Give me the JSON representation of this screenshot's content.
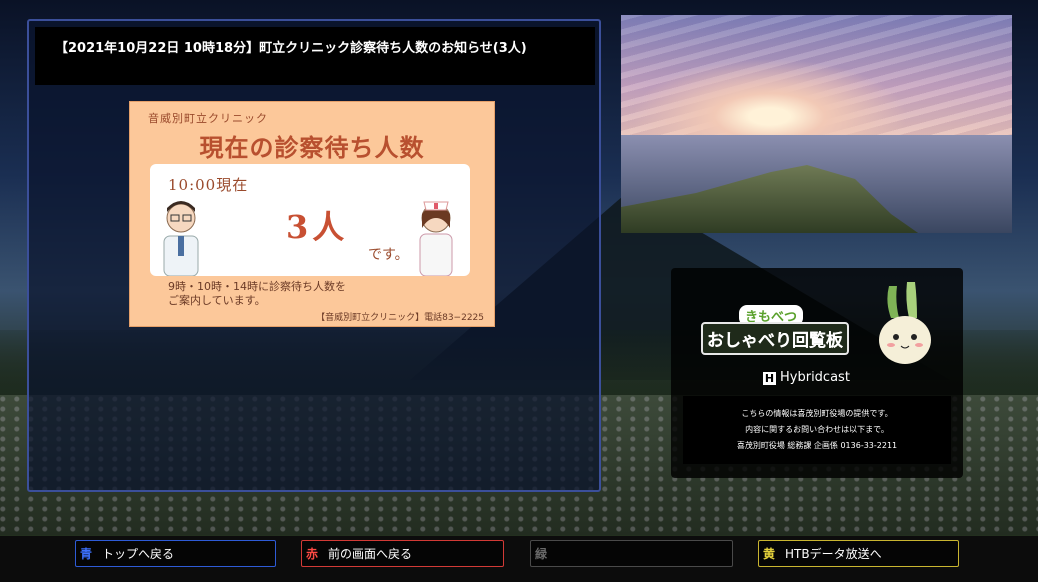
{
  "panel": {
    "title": "【2021年10月22日 10時18分】町立クリニック診察待ち人数のお知らせ(3人)"
  },
  "notice": {
    "clinic_name": "音威別町立クリニック",
    "headline": "現在の診察待ち人数",
    "time": "10:00現在",
    "count": "3人",
    "suffix": "です。",
    "info": "9時・10時・14時に診察待ち人数を\nご案内しています。",
    "contact": "【音威別町立クリニック】電話83−2225"
  },
  "hybridcast_panel": {
    "sub_title": "きもべつ",
    "title": "おしゃべり回覧板",
    "logo_text": "Hybridcast",
    "info_lines": [
      "こちらの情報は喜茂別町役場の提供です。",
      "内容に関するお問い合わせは以下まで。",
      "喜茂別町役場 総務課 企画係 0136-33-2211"
    ]
  },
  "buttons": {
    "blue": {
      "key": "青",
      "label": "トップへ戻る",
      "color": "#2e5bd6"
    },
    "red": {
      "key": "赤",
      "label": "前の画面へ戻る",
      "color": "#d23a36"
    },
    "green": {
      "key": "緑",
      "label": "",
      "color": "#4a4a4a"
    },
    "yellow": {
      "key": "黄",
      "label": "HTBデータ放送へ",
      "color": "#c9b530"
    }
  }
}
